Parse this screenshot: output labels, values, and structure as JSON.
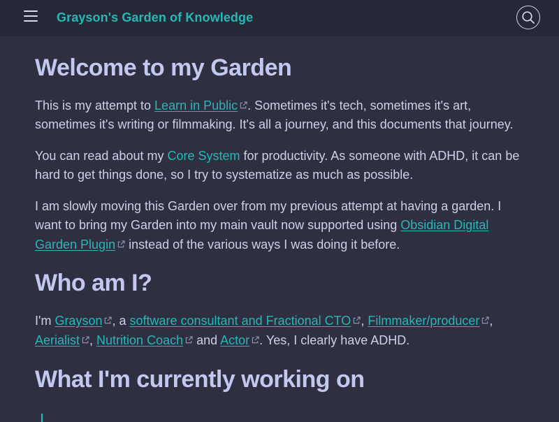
{
  "header": {
    "menu_icon": "hamburger-menu-icon",
    "title": "Grayson's Garden of Knowledge",
    "search_icon": "search-icon",
    "accent_color": "#27b8b5",
    "background_color": "#262838"
  },
  "main": {
    "welcome_heading": "Welcome to my Garden",
    "p1": {
      "before": "This is my attempt to ",
      "link": "Learn in Public",
      "after": ". Sometimes it's tech, sometimes it's art, sometimes it's writing or filmmaking. It's all a journey, and this documents that journey."
    },
    "p2": {
      "before": "You can read about my ",
      "link": "Core System",
      "after": " for productivity. As someone with ADHD, it can be hard to get things done, so I try to systematize as much as possible."
    },
    "p3": {
      "before": "I am slowly moving this Garden over from my previous attempt at having a garden. I want to bring my Garden into my main vault now supported using ",
      "link": "Obsidian Digital Garden Plugin",
      "after": " instead of the various ways I was doing it before."
    },
    "who_heading": "Who am I?",
    "p4": {
      "prefix": "I'm ",
      "link_grayson": "Grayson",
      "sep1": ", a ",
      "link_consultant": "software consultant and Fractional CTO",
      "sep2": ", ",
      "link_filmmaker": "Filmmaker/producer",
      "sep3": ", ",
      "link_aerialist": "Aerialist",
      "sep4": ", ",
      "link_nutrition": "Nutrition Coach",
      "sep5": " and ",
      "link_actor": "Actor",
      "suffix": ". Yes, I clearly have ADHD."
    },
    "working_heading": "What I'm currently working on",
    "external_link_icon": "external-link-icon"
  }
}
